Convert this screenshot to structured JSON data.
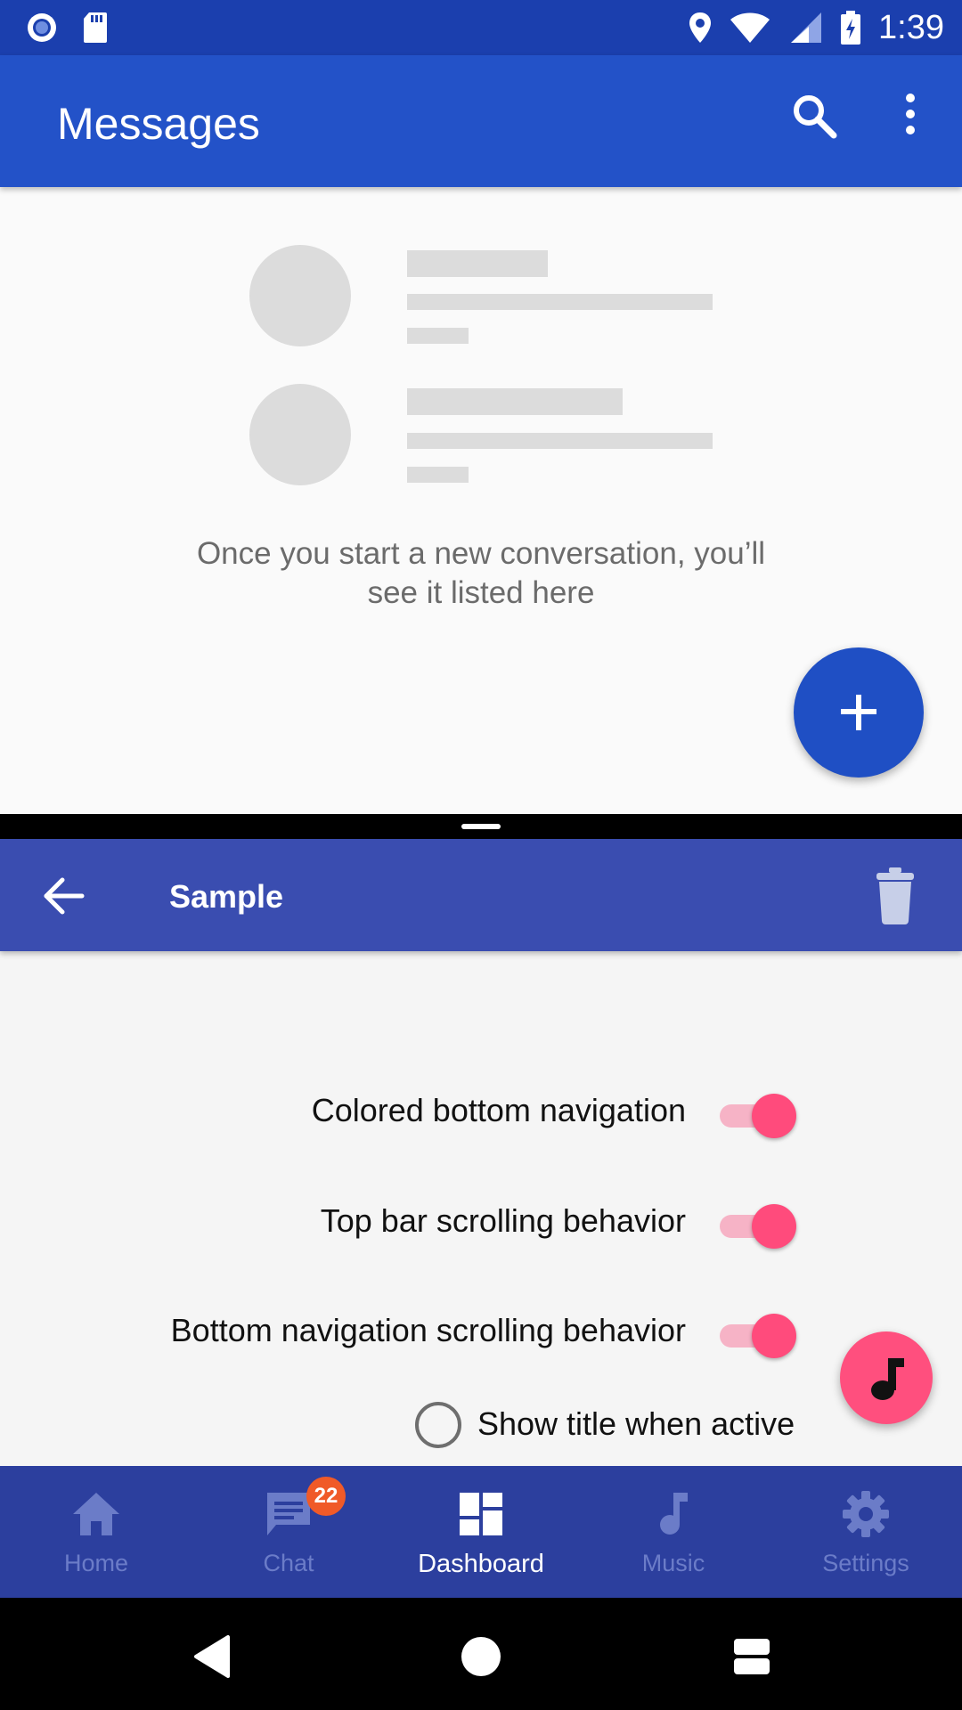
{
  "status_bar": {
    "time": "1:39",
    "left_icons": [
      "record-icon",
      "sd-card-icon"
    ],
    "right_icons": [
      "location-icon",
      "wifi-icon",
      "signal-icon",
      "battery-charging-icon"
    ]
  },
  "messages": {
    "title": "Messages",
    "empty_text_line1": "Once you start a new conversation, you’ll",
    "empty_text_line2": "see it listed here",
    "primary_color": "#2352c8"
  },
  "sample": {
    "title": "Sample",
    "settings": [
      {
        "label": "Colored bottom navigation",
        "on": true
      },
      {
        "label": "Top bar scrolling behavior",
        "on": true
      },
      {
        "label": "Bottom navigation scrolling behavior",
        "on": true
      }
    ],
    "radio": {
      "label": "Show title when active",
      "checked": false
    },
    "accent_color": "#ff4b7c",
    "primary_color": "#3a4db0"
  },
  "bottom_nav": {
    "items": [
      {
        "label": "Home",
        "icon": "home-icon"
      },
      {
        "label": "Chat",
        "icon": "chat-icon",
        "badge": "22"
      },
      {
        "label": "Dashboard",
        "icon": "dashboard-icon",
        "active": true
      },
      {
        "label": "Music",
        "icon": "music-note-icon"
      },
      {
        "label": "Settings",
        "icon": "gear-icon"
      }
    ]
  },
  "system_nav": {
    "buttons": [
      "back-icon",
      "home-icon",
      "recents-icon"
    ]
  }
}
